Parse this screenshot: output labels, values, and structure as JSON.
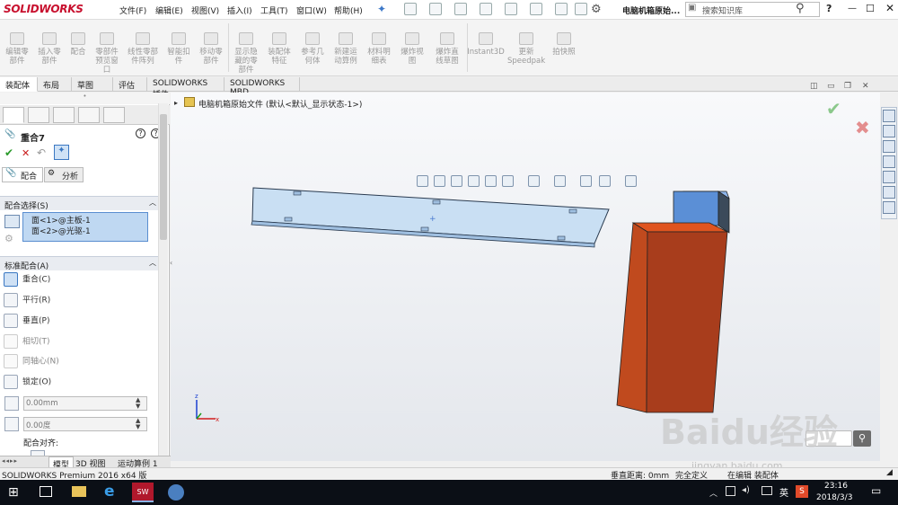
{
  "app": {
    "logo": "SOLIDWORKS",
    "window_title": "电脑机箱原始..."
  },
  "menu": [
    "文件(F)",
    "编辑(E)",
    "视图(V)",
    "插入(I)",
    "工具(T)",
    "窗口(W)",
    "帮助(H)"
  ],
  "search": {
    "placeholder": "搜索知识库"
  },
  "ribbon": [
    "编辑零\n部件",
    "插入零\n部件",
    "配合",
    "零部件\n预览窗\n口",
    "线性零部\n件阵列",
    "智能扣\n件",
    "移动零\n部件",
    "显示隐\n藏的零\n部件",
    "装配体\n特征",
    "参考几\n何体",
    "新建运\n动算例",
    "材料明\n细表",
    "爆炸视\n图",
    "爆炸直\n线草图",
    "Instant3D",
    "更新\nSpeedpak",
    "拍快照"
  ],
  "tabs": [
    "装配体",
    "布局",
    "草图",
    "评估",
    "SOLIDWORKS 插件",
    "SOLIDWORKS MBD"
  ],
  "property_manager": {
    "title": "重合7",
    "subtabs": [
      "配合",
      "分析"
    ],
    "selection_header": "配合选择(S)",
    "selections": [
      "面<1>@主板-1",
      "面<2>@光驱-1"
    ],
    "standard_header": "标准配合(A)",
    "mates": [
      "重合(C)",
      "平行(R)",
      "垂直(P)",
      "相切(T)",
      "同轴心(N)",
      "锁定(O)"
    ],
    "distance_value": "0.00mm",
    "angle_value": "0.00度",
    "align_label": "配合对齐:"
  },
  "tree": {
    "root": "电脑机箱原始文件 (默认<默认_显示状态-1>)"
  },
  "bottom_tabs": [
    "模型",
    "3D 视图",
    "运动算例 1"
  ],
  "status": {
    "product": "SOLIDWORKS Premium 2016 x64 版",
    "distance": "垂直距离: 0mm",
    "state": "完全定义",
    "edit": "在编辑 装配体"
  },
  "taskbar": {
    "time": "23:16",
    "date": "2018/3/3",
    "ime": "英"
  },
  "watermark": {
    "text": "Baidu经验",
    "url": "jingyan.baidu.com"
  },
  "colors": {
    "accent": "#c8102e",
    "plate": "#c9dff3",
    "box_red": "#b8401e",
    "box_blue": "#5b8fd6"
  }
}
